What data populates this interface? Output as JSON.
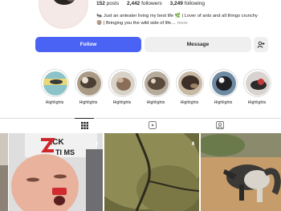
{
  "profile": {
    "stats": {
      "posts_count": "152",
      "posts_label": "posts",
      "followers_count": "2,442",
      "followers_label": "followers",
      "following_count": "3,249",
      "following_label": "following"
    },
    "bio_line1": "🐜 Just an anteater living my best life 🌿 | Lover of ants and all things crunchy",
    "bio_line2": "🦥 | Bringing you the wild side of life…",
    "bio_more": " more"
  },
  "actions": {
    "follow_label": "Follow",
    "message_label": "Message"
  },
  "highlights": [
    {
      "label": "Highlights"
    },
    {
      "label": "Highlights"
    },
    {
      "label": "Highlights"
    },
    {
      "label": "Highlights"
    },
    {
      "label": "Highlights"
    },
    {
      "label": "Highlights"
    },
    {
      "label": "Highlights"
    }
  ],
  "tabs": [
    "posts-grid",
    "reels",
    "tagged"
  ],
  "grid_text": {
    "sticker_text": "ZCK\nTI MS"
  },
  "colors": {
    "accent": "#4a63f5",
    "button_grey": "#efefef",
    "divider": "#dbdbdb"
  }
}
